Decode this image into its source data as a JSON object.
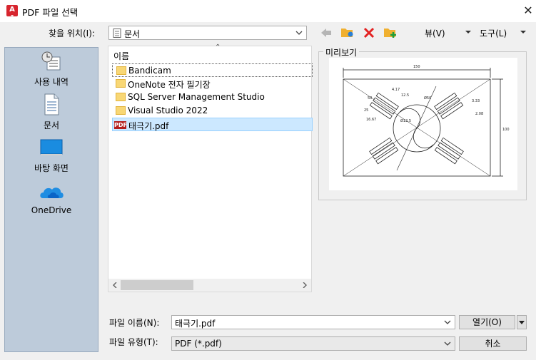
{
  "window": {
    "title": "PDF 파일 선택",
    "close_glyph": "✕"
  },
  "toolbar": {
    "lookin_label": "찾을 위치(I):",
    "lookin_value": "문서",
    "view_label": "뷰(V)",
    "tools_label": "도구(L)",
    "icons": [
      "back-icon",
      "new-folder-search-icon",
      "delete-icon",
      "new-folder-icon"
    ]
  },
  "places": [
    {
      "label": "사용 내역",
      "icon": "history-icon"
    },
    {
      "label": "문서",
      "icon": "documents-icon"
    },
    {
      "label": "바탕 화면",
      "icon": "desktop-icon"
    },
    {
      "label": "OneDrive",
      "icon": "onedrive-icon"
    }
  ],
  "filelist": {
    "header": "이름",
    "sort_glyph": "⌃",
    "items": [
      {
        "name": "Bandicam",
        "type": "folder"
      },
      {
        "name": "OneNote 전자 필기장",
        "type": "folder"
      },
      {
        "name": "SQL Server Management Studio",
        "type": "folder"
      },
      {
        "name": "Visual Studio 2022",
        "type": "folder"
      },
      {
        "name": "태극기.pdf",
        "type": "pdf"
      }
    ],
    "selected": "태극기.pdf",
    "pdf_badge": "PDF"
  },
  "preview": {
    "label": "미리보기",
    "drawing_text": [
      "150",
      "100",
      "50",
      "4.17",
      "12.5",
      "Ø50",
      "25",
      "Ø12.5",
      "16.67",
      "2.08",
      "3.33"
    ]
  },
  "filename": {
    "label": "파일 이름(N):",
    "value": "태극기.pdf"
  },
  "filetype": {
    "label": "파일 유형(T):",
    "value": "PDF (*.pdf)"
  },
  "buttons": {
    "open": "열기(O)",
    "cancel": "취소"
  },
  "colors": {
    "sidebar": "#bdcbda",
    "selection": "#cce8ff",
    "app_red": "#d7252e"
  }
}
